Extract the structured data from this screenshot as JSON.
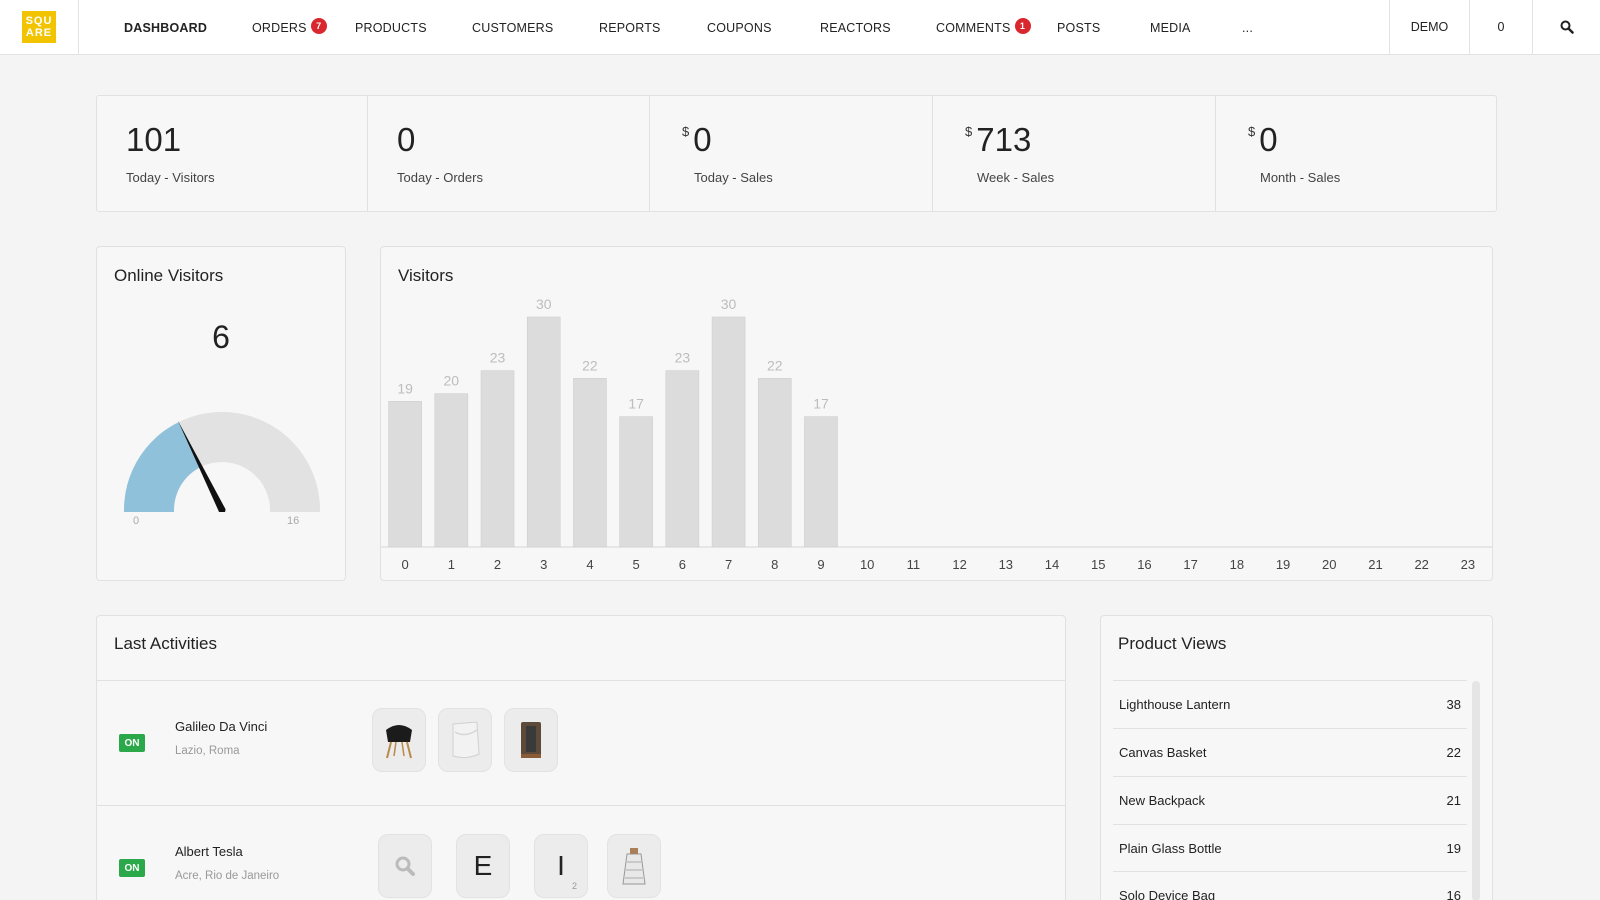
{
  "nav": {
    "logo_line1": "SQU",
    "logo_line2": "ARE",
    "items": [
      {
        "label": "DASHBOARD",
        "active": true
      },
      {
        "label": "ORDERS",
        "badge": "7"
      },
      {
        "label": "PRODUCTS"
      },
      {
        "label": "CUSTOMERS"
      },
      {
        "label": "REPORTS"
      },
      {
        "label": "COUPONS"
      },
      {
        "label": "REACTORS"
      },
      {
        "label": "COMMENTS",
        "badge": "1"
      },
      {
        "label": "POSTS"
      },
      {
        "label": "MEDIA"
      },
      {
        "label": "..."
      }
    ],
    "demo": "DEMO",
    "cart_count": "0",
    "search_icon": "search-icon"
  },
  "stats": [
    {
      "currency": "",
      "value": "101",
      "label": "Today - Visitors"
    },
    {
      "currency": "",
      "value": "0",
      "label": "Today - Orders"
    },
    {
      "currency": "$",
      "value": "0",
      "label": "Today - Sales"
    },
    {
      "currency": "$",
      "value": "713",
      "label": "Week - Sales"
    },
    {
      "currency": "$",
      "value": "0",
      "label": "Month - Sales"
    }
  ],
  "online_visitors": {
    "title": "Online Visitors",
    "value": "6",
    "min": "0",
    "max": "16",
    "level": 6
  },
  "visitors_chart": {
    "title": "Visitors"
  },
  "chart_data": {
    "type": "bar",
    "categories": [
      "0",
      "1",
      "2",
      "3",
      "4",
      "5",
      "6",
      "7",
      "8",
      "9",
      "10",
      "11",
      "12",
      "13",
      "14",
      "15",
      "16",
      "17",
      "18",
      "19",
      "20",
      "21",
      "22",
      "23"
    ],
    "values": [
      19,
      20,
      23,
      30,
      22,
      17,
      23,
      30,
      22,
      17,
      null,
      null,
      null,
      null,
      null,
      null,
      null,
      null,
      null,
      null,
      null,
      null,
      null,
      null
    ],
    "title": "Visitors",
    "xlabel": "",
    "ylabel": "",
    "ylim": [
      0,
      30
    ],
    "grid": false,
    "color": "#dcdcdc"
  },
  "activities": {
    "title": "Last Activities",
    "rows": [
      {
        "status": "ON",
        "name": "Galileo Da Vinci",
        "location": "Lazio, Roma",
        "thumbs": [
          "chair-thumbnail",
          "bag-thumbnail",
          "backpack-thumbnail"
        ]
      },
      {
        "status": "ON",
        "name": "Albert Tesla",
        "location": "Acre, Rio de Janeiro",
        "thumbs": [
          "search-icon",
          "E",
          "I",
          "grater-thumbnail"
        ],
        "thumb_sub": "2"
      }
    ]
  },
  "product_views": {
    "title": "Product Views",
    "items": [
      {
        "name": "Lighthouse Lantern",
        "count": "38"
      },
      {
        "name": "Canvas Basket",
        "count": "22"
      },
      {
        "name": "New Backpack",
        "count": "21"
      },
      {
        "name": "Plain Glass Bottle",
        "count": "19"
      },
      {
        "name": "Solo Device Bag",
        "count": "16"
      }
    ]
  },
  "colors": {
    "accent_logo": "#f2c400",
    "badge_red": "#d9272e",
    "status_green": "#2aa84a",
    "gauge_fill": "#8fc1db",
    "gauge_track": "#e2e2e2"
  }
}
